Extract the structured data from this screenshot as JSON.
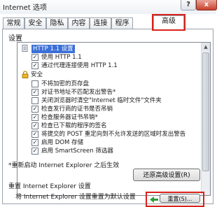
{
  "window": {
    "title": "Internet 选项",
    "help_label": "?",
    "close_label": "x"
  },
  "tabs": [
    {
      "label": "常规"
    },
    {
      "label": "安全"
    },
    {
      "label": "隐私"
    },
    {
      "label": "内容"
    },
    {
      "label": "连接"
    },
    {
      "label": "程序"
    },
    {
      "label": "高级",
      "active": true
    }
  ],
  "settings_group": {
    "title": "设置",
    "items": [
      {
        "kind": "item",
        "label": "HTTP 1.1 设置",
        "checked": false,
        "highlighted": true,
        "icon": "http-settings-icon"
      },
      {
        "kind": "item",
        "label": "使用 HTTP 1.1",
        "checked": true
      },
      {
        "kind": "item",
        "label": "通过代理连接使用 HTTP 1.1",
        "checked": true
      },
      {
        "kind": "category",
        "label": "安全",
        "icon": "lock-icon"
      },
      {
        "kind": "item",
        "label": "不将加密的页存盘",
        "checked": false
      },
      {
        "kind": "item",
        "label": "对证书地址不匹配发出警告*",
        "checked": true
      },
      {
        "kind": "item",
        "label": "关闭浏览器时清空\"Internet 临时文件\"文件夹",
        "checked": false
      },
      {
        "kind": "item",
        "label": "检查发行商的证书是否吊销",
        "checked": true
      },
      {
        "kind": "item",
        "label": "检查服务器证书吊销*",
        "checked": true
      },
      {
        "kind": "item",
        "label": "检查已下载的程序的签名",
        "checked": true
      },
      {
        "kind": "item",
        "label": "将提交的 POST 重定向到不允许发送的区域时发出警告",
        "checked": true
      },
      {
        "kind": "item",
        "label": "启用 DOM 存储",
        "checked": true
      },
      {
        "kind": "item",
        "label": "启用 SmartScreen 筛选器",
        "checked": true
      }
    ]
  },
  "restart_note": "*重新启动 Internet Explorer 之后生效",
  "restore_button_label": "还原高级设置(R)",
  "reset_group": {
    "title": "重置 Internet Explorer 设置",
    "description": "将 Internet Explorer 设置重置为默认设置",
    "button_label": "重置(S)..."
  },
  "colors": {
    "highlight_box": "#d8221b",
    "selection": "#3a6fd8",
    "arrow": "#2e9e3a"
  }
}
